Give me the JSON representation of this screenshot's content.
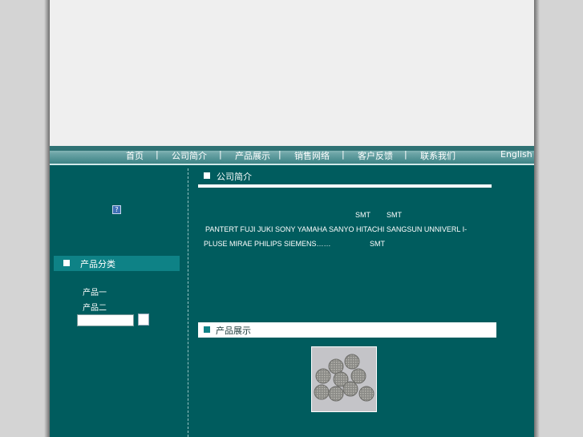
{
  "nav": {
    "items": [
      "首页",
      "公司简介",
      "产品展示",
      "销售网络",
      "客户反馈",
      "联系我们"
    ],
    "separator": "|",
    "english": "English"
  },
  "left": {
    "icon_glyph": "?",
    "category_title": "产品分类",
    "links": [
      "产品一",
      "产品二"
    ],
    "search_value": ""
  },
  "section1": {
    "title": "公司简介",
    "line1_a": "SMT",
    "line1_b": "SMT",
    "line2": "PANTERT FUJI JUKI SONY YAMAHA SANYO HITACHI SANGSUN UNNIVERL I-",
    "line3_a": "PLUSE MIRAE PHILIPS SIEMENS……",
    "line3_b": "SMT"
  },
  "section2": {
    "title": "产品展示"
  },
  "colors": {
    "page_bg": "#005c5e",
    "banner": "#efefef",
    "accent": "#0e8286",
    "outer_bg": "#d4d4d4"
  },
  "icons": {
    "left_icon": "help-icon",
    "bullets": "square-bullet-icon"
  }
}
